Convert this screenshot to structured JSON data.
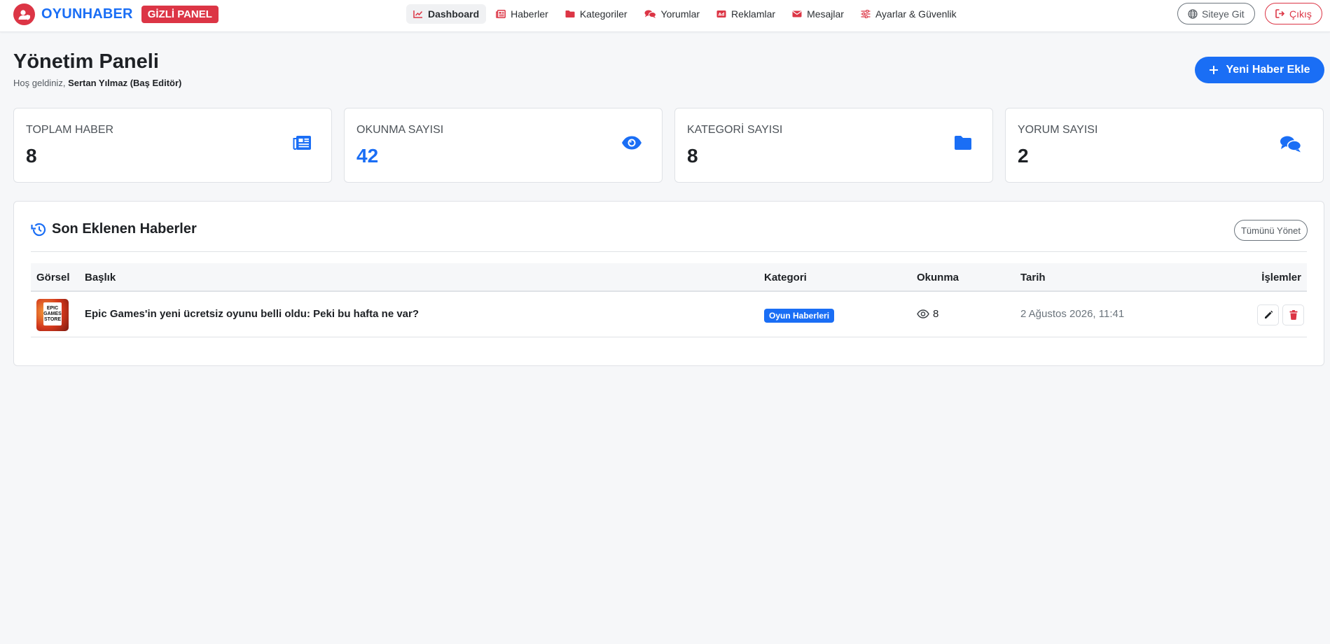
{
  "brand": {
    "name": "OYUNHABER",
    "badge": "GİZLİ PANEL"
  },
  "nav": {
    "items": [
      {
        "label": "Dashboard",
        "icon": "chart-line-icon",
        "active": true
      },
      {
        "label": "Haberler",
        "icon": "newspaper-icon"
      },
      {
        "label": "Kategoriler",
        "icon": "folder-icon"
      },
      {
        "label": "Yorumlar",
        "icon": "comments-icon"
      },
      {
        "label": "Reklamlar",
        "icon": "ad-icon"
      },
      {
        "label": "Mesajlar",
        "icon": "envelope-icon"
      },
      {
        "label": "Ayarlar & Güvenlik",
        "icon": "sliders-icon"
      }
    ],
    "site_button": "Siteye Git",
    "exit_button": "Çıkış"
  },
  "header": {
    "title": "Yönetim Paneli",
    "welcome_prefix": "Hoş geldiniz,",
    "user": "Sertan Yılmaz (Baş Editör)",
    "add_button": "Yeni Haber Ekle"
  },
  "stats": [
    {
      "label": "TOPLAM HABER",
      "value": "8",
      "icon": "newspaper-icon"
    },
    {
      "label": "OKUNMA SAYISI",
      "value": "42",
      "icon": "eye-icon"
    },
    {
      "label": "KATEGORİ SAYISI",
      "value": "8",
      "icon": "folder-icon"
    },
    {
      "label": "YORUM SAYISI",
      "value": "2",
      "icon": "comments-icon"
    }
  ],
  "recent": {
    "title": "Son Eklenen Haberler",
    "manage_all": "Tümünü Yönet",
    "columns": [
      "Görsel",
      "Başlık",
      "Kategori",
      "Okunma",
      "Tarih",
      "İşlemler"
    ],
    "rows": [
      {
        "thumb_text": [
          "EPIC",
          "GAMES",
          "STORE"
        ],
        "title": "Epic Games'in yeni ücretsiz oyunu belli oldu: Peki bu hafta ne var?",
        "category": "Oyun Haberleri",
        "views": "8",
        "date": "2 Ağustos 2026, 11:41"
      }
    ]
  },
  "colors": {
    "accent": "#1a6ef5",
    "danger": "#dc3545"
  }
}
